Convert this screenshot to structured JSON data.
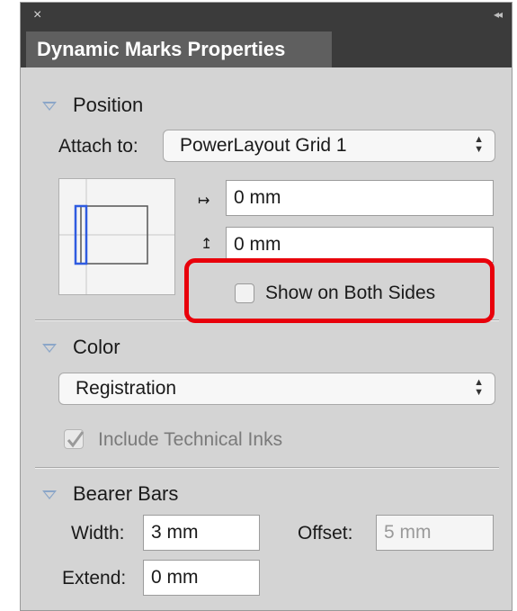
{
  "window": {
    "title": "Dynamic Marks Properties",
    "close_glyph": "×",
    "collapse_glyph": "◂◂"
  },
  "position": {
    "section_label": "Position",
    "attach_label": "Attach to:",
    "attach_value": "PowerLayout Grid 1",
    "horizontal_offset": "0 mm",
    "vertical_offset": "0 mm",
    "show_both_sides_label": "Show on Both Sides",
    "show_both_sides_checked": false,
    "horizontal_icon": "↦",
    "vertical_icon": "↥"
  },
  "color": {
    "section_label": "Color",
    "value": "Registration",
    "include_inks_label": "Include Technical Inks",
    "include_inks_checked": true
  },
  "bearer_bars": {
    "section_label": "Bearer Bars",
    "width_label": "Width:",
    "width_value": "3 mm",
    "offset_label": "Offset:",
    "offset_value": "5 mm",
    "extend_label": "Extend:",
    "extend_value": "0 mm"
  },
  "colors": {
    "highlight": "#e8000b",
    "disclosure_triangle": "#8ba6c8",
    "preview_mark": "#2f5be0"
  }
}
